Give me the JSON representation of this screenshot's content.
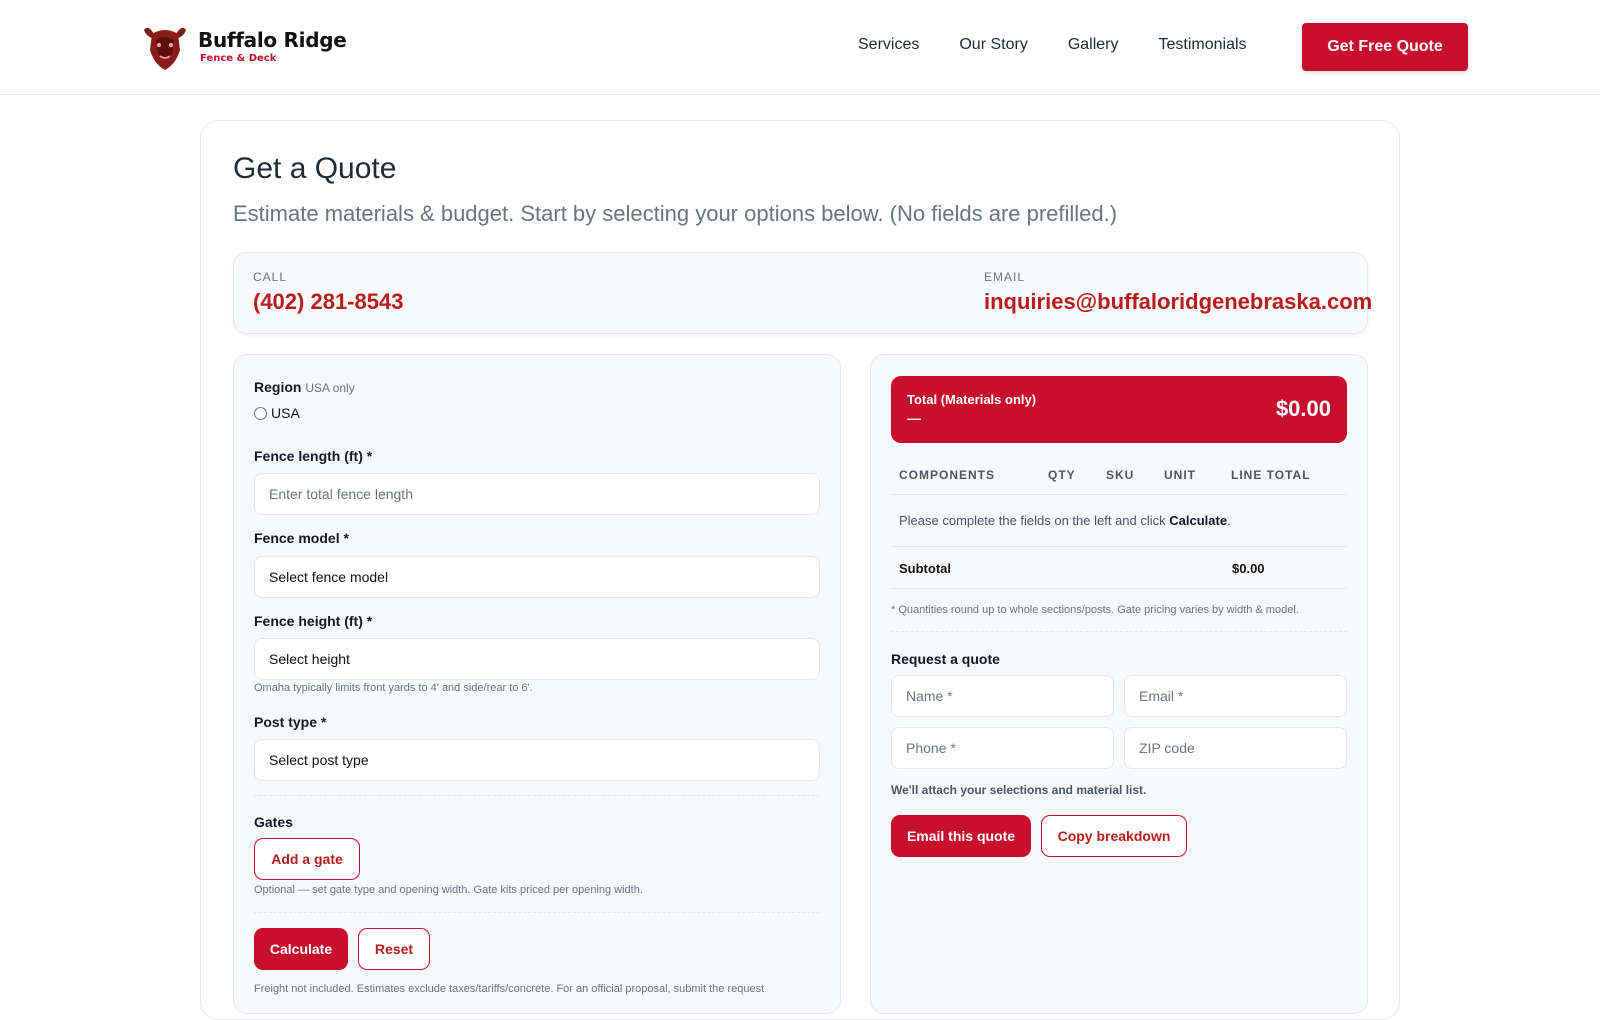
{
  "brand": {
    "name": "Buffalo Ridge",
    "tagline": "Fence & Deck",
    "accent_color": "#c8102e"
  },
  "nav": {
    "items": [
      "Services",
      "Our Story",
      "Gallery",
      "Testimonials"
    ],
    "cta_label": "Get Free Quote"
  },
  "page": {
    "title": "Get a Quote",
    "subtitle": "Estimate materials & budget. Start by selecting your options below. (No fields are prefilled.)"
  },
  "contact": {
    "call_label": "CALL",
    "phone": "(402) 281-8543",
    "email_label": "EMAIL",
    "email": "inquiries@buffaloridgenebraska.com"
  },
  "form": {
    "region_label": "Region",
    "region_note": "USA only",
    "region_option": "USA",
    "length_label": "Fence length (ft) *",
    "length_placeholder": "Enter total fence length",
    "model_label": "Fence model *",
    "model_value": "Select fence model",
    "height_label": "Fence height (ft) *",
    "height_value": "Select height",
    "height_hint": "Omaha typically limits front yards to 4' and side/rear to 6'.",
    "post_label": "Post type *",
    "post_value": "Select post type",
    "gates_label": "Gates",
    "add_gate_label": "Add a gate",
    "gates_hint": "Optional — set gate type and opening width. Gate kits priced per opening width.",
    "calculate_label": "Calculate",
    "reset_label": "Reset",
    "footnote": "Freight not included. Estimates exclude taxes/tariffs/concrete. For an official proposal, submit the request"
  },
  "summary": {
    "total_label": "Total (Materials only)",
    "total_dash": "—",
    "total_amount": "$0.00",
    "columns": [
      "COMPONENTS",
      "QTY",
      "SKU",
      "UNIT",
      "LINE TOTAL"
    ],
    "empty_message_prefix": "Please complete the fields on the left and click ",
    "empty_message_action": "Calculate",
    "empty_message_suffix": ".",
    "subtotal_label": "Subtotal",
    "subtotal_value": "$0.00",
    "note": "* Quantities round up to whole sections/posts. Gate pricing varies by width & model."
  },
  "request": {
    "title": "Request a quote",
    "name_placeholder": "Name *",
    "email_placeholder": "Email *",
    "phone_placeholder": "Phone *",
    "zip_placeholder": "ZIP code",
    "attach_note": "We'll attach your selections and material list.",
    "email_button": "Email this quote",
    "copy_button": "Copy breakdown"
  }
}
